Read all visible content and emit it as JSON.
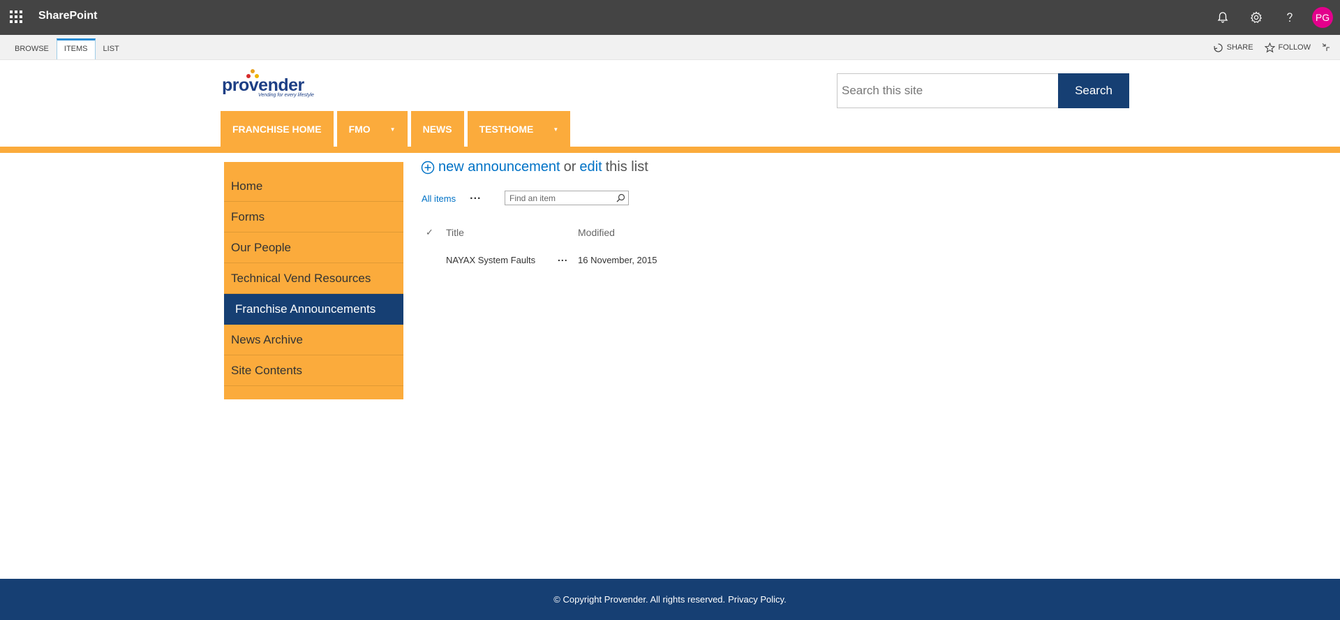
{
  "suitebar": {
    "title": "SharePoint",
    "avatar_initials": "PG"
  },
  "ribbon": {
    "tabs": [
      {
        "label": "BROWSE"
      },
      {
        "label": "ITEMS"
      },
      {
        "label": "LIST"
      }
    ],
    "active_tab": "ITEMS",
    "share_label": "SHARE",
    "follow_label": "FOLLOW"
  },
  "header": {
    "logo_text": "provender",
    "logo_tagline": "Vending for every lifestyle",
    "search_placeholder": "Search this site",
    "search_button": "Search"
  },
  "topnav": [
    {
      "label": "FRANCHISE HOME",
      "dropdown": false
    },
    {
      "label": "FMO",
      "dropdown": true
    },
    {
      "label": "NEWS",
      "dropdown": false
    },
    {
      "label": "TESTHOME",
      "dropdown": true
    }
  ],
  "leftnav": [
    {
      "label": "Home"
    },
    {
      "label": "Forms"
    },
    {
      "label": "Our People"
    },
    {
      "label": "Technical Vend Resources"
    },
    {
      "label": "Franchise Announcements"
    },
    {
      "label": "News Archive"
    },
    {
      "label": "Site Contents"
    }
  ],
  "leftnav_selected": "Franchise Announcements",
  "content": {
    "new_link": "new announcement",
    "or_text": "or",
    "edit_link": "edit",
    "this_list_text": "this list",
    "view_all": "All items",
    "view_more": "...",
    "find_placeholder": "Find an item",
    "columns": {
      "check": "✓",
      "title": "Title",
      "modified": "Modified"
    },
    "rows": [
      {
        "title": "NAYAX System Faults",
        "menu": "...",
        "modified": "16 November, 2015"
      }
    ]
  },
  "footer": {
    "copyright": "© Copyright Provender. All rights reserved.",
    "privacy": "Privacy Policy."
  },
  "colors": {
    "suitebar": "#444444",
    "brand_orange": "#fbab3c",
    "brand_navy": "#163f73",
    "link_blue": "#0072c6",
    "avatar": "#e3008c"
  }
}
